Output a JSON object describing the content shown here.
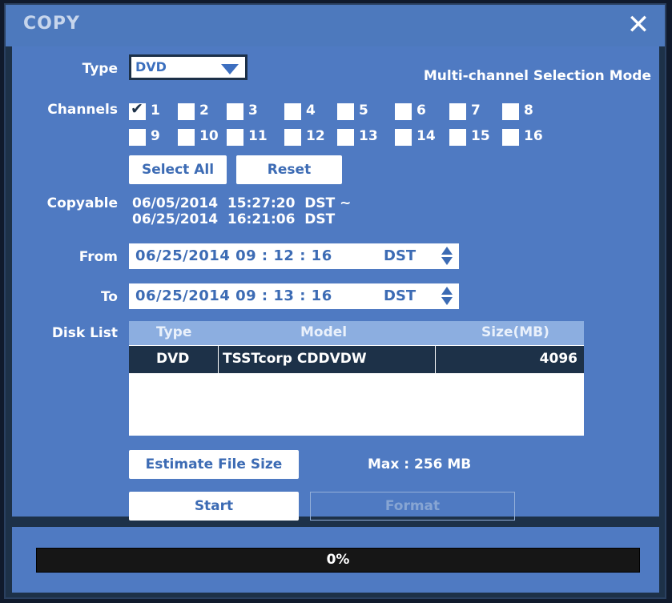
{
  "window": {
    "title": "COPY",
    "close_icon": "close-icon"
  },
  "type": {
    "label": "Type",
    "value": "DVD",
    "mode_label": "Multi-channel Selection Mode"
  },
  "channels": {
    "label": "Channels",
    "items": [
      {
        "num": "1",
        "checked": true
      },
      {
        "num": "2",
        "checked": false
      },
      {
        "num": "3",
        "checked": false
      },
      {
        "num": "4",
        "checked": false
      },
      {
        "num": "5",
        "checked": false
      },
      {
        "num": "6",
        "checked": false
      },
      {
        "num": "7",
        "checked": false
      },
      {
        "num": "8",
        "checked": false
      },
      {
        "num": "9",
        "checked": false
      },
      {
        "num": "10",
        "checked": false
      },
      {
        "num": "11",
        "checked": false
      },
      {
        "num": "12",
        "checked": false
      },
      {
        "num": "13",
        "checked": false
      },
      {
        "num": "14",
        "checked": false
      },
      {
        "num": "15",
        "checked": false
      },
      {
        "num": "16",
        "checked": false
      }
    ],
    "select_all": "Select All",
    "reset": "Reset"
  },
  "copyable": {
    "label": "Copyable",
    "line1": "06/05/2014  15:27:20  DST ~",
    "line2": "06/25/2014  16:21:06  DST"
  },
  "from": {
    "label": "From",
    "datetime": "06/25/2014  09 : 12 : 16",
    "tz": "DST"
  },
  "to": {
    "label": "To",
    "datetime": "06/25/2014  09 : 13 : 16",
    "tz": "DST"
  },
  "disk_list": {
    "label": "Disk List",
    "columns": [
      "Type",
      "Model",
      "Size(MB)"
    ],
    "rows": [
      {
        "type": "DVD",
        "model": "TSSTcorp CDDVDW",
        "size": "4096"
      }
    ]
  },
  "estimate": {
    "button": "Estimate File Size",
    "max_text": "Max : 256 MB"
  },
  "actions": {
    "start": "Start",
    "format": "Format"
  },
  "progress": {
    "value": 0,
    "label": "0%"
  },
  "colors": {
    "accent": "#4f7ac2",
    "title_bar": "#4d79bd",
    "dark": "#1d3148"
  }
}
